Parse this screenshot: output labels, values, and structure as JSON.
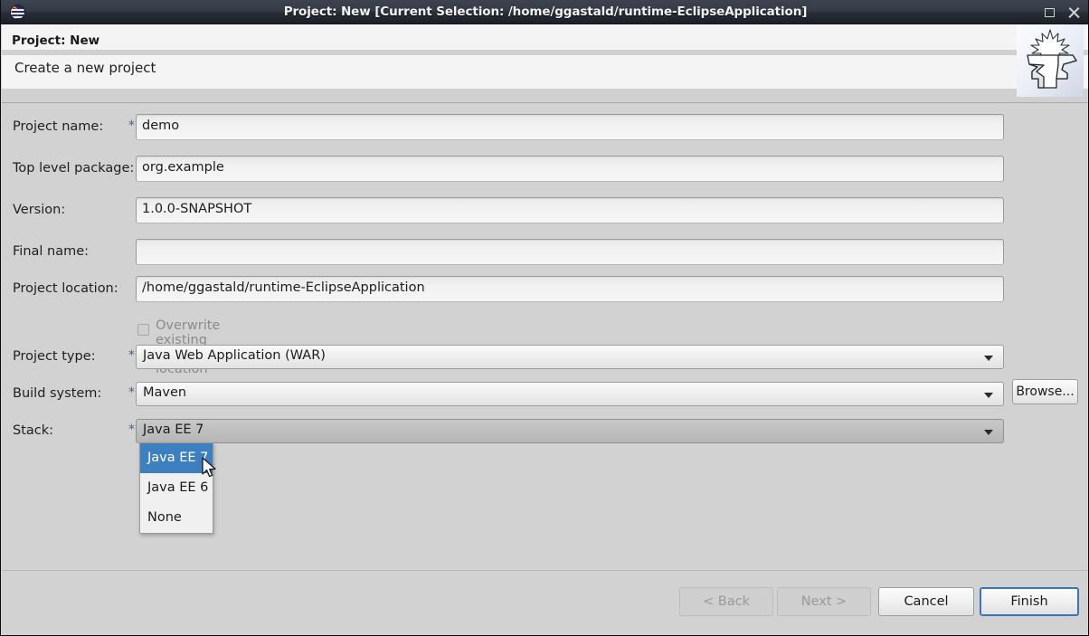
{
  "window": {
    "title": "Project: New [Current Selection: /home/ggastald/runtime-EclipseApplication]",
    "app_icon": "eclipse-icon",
    "controls": {
      "maximize": "maximize-icon",
      "close": "close-icon"
    }
  },
  "banner": {
    "title": "Project: New",
    "subtitle": "Create a new project",
    "art": "anvil-forge-icon"
  },
  "form": {
    "required_marker": "*",
    "fields": [
      {
        "label": "Project name:",
        "required": true,
        "type": "text",
        "value": "demo"
      },
      {
        "label": "Top level package:",
        "required": false,
        "type": "text",
        "value": "org.example"
      },
      {
        "label": "Version:",
        "required": false,
        "type": "text",
        "value": "1.0.0-SNAPSHOT"
      },
      {
        "label": "Final name:",
        "required": false,
        "type": "text",
        "value": ""
      },
      {
        "label": "Project location:",
        "required": false,
        "type": "text",
        "value": "/home/ggastald/runtime-EclipseApplication"
      },
      {
        "label": "Project type:",
        "required": true,
        "type": "combo",
        "value": "Java Web Application (WAR)"
      },
      {
        "label": "Build system:",
        "required": true,
        "type": "combo",
        "value": "Maven"
      },
      {
        "label": "Stack:",
        "required": true,
        "type": "combo",
        "value": "Java EE 7"
      }
    ],
    "browse_button": "Browse...",
    "overwrite_checkbox": {
      "label": "Overwrite existing project location",
      "checked": false,
      "enabled": false
    }
  },
  "stack_dropdown": {
    "open": true,
    "options": [
      "Java EE 7",
      "Java EE 6",
      "None"
    ],
    "selected": "Java EE 7"
  },
  "footer": {
    "buttons": [
      {
        "label": "< Back",
        "state": "disabled"
      },
      {
        "label": "Next >",
        "state": "disabled"
      },
      {
        "label": "Cancel",
        "state": "normal"
      },
      {
        "label": "Finish",
        "state": "default-focused"
      }
    ]
  },
  "colors": {
    "titlebar": "#333b46",
    "dialog_background": "#d2d2d2",
    "banner_background": "#f4f4f4",
    "selection_blue": "#3e7fbf",
    "focus_border": "#3a76c0",
    "required_asterisk": "#4b5d7e",
    "disabled_text": "#8a8a8a"
  }
}
